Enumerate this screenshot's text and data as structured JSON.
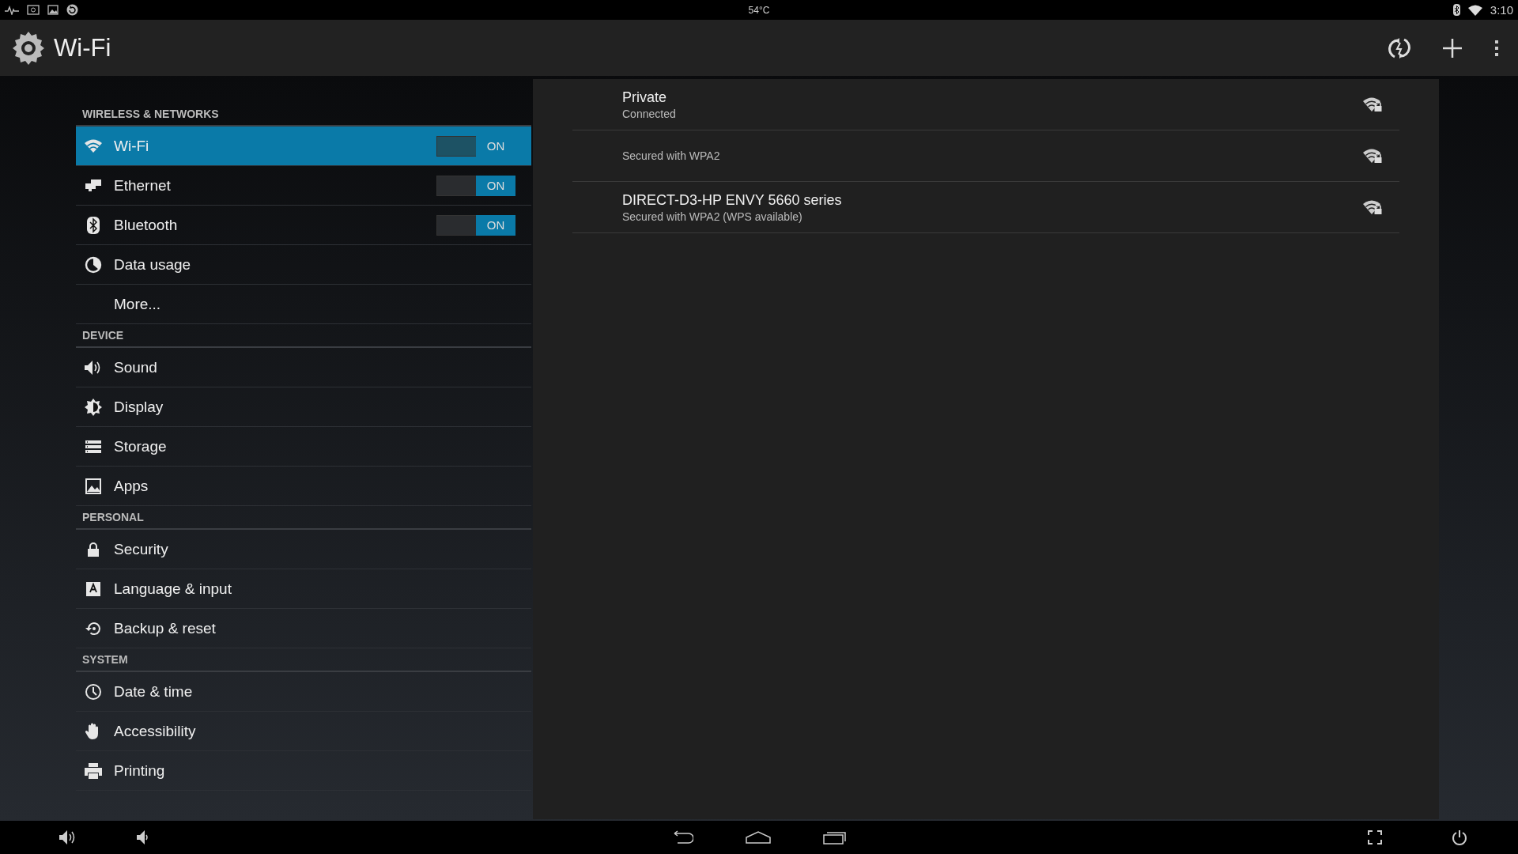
{
  "status_bar": {
    "temperature": "54°C",
    "time": "3:10"
  },
  "action_bar": {
    "title": "Wi-Fi"
  },
  "sections": [
    {
      "title": "WIRELESS & NETWORKS",
      "items": [
        {
          "label": "Wi-Fi",
          "selected": true,
          "toggle": {
            "label": "ON",
            "on": true
          }
        },
        {
          "label": "Ethernet",
          "selected": false,
          "toggle": {
            "label": "ON",
            "on": true
          }
        },
        {
          "label": "Bluetooth",
          "selected": false,
          "toggle": {
            "label": "ON",
            "on": true
          }
        },
        {
          "label": "Data usage",
          "selected": false
        },
        {
          "label": "More...",
          "selected": false
        }
      ]
    },
    {
      "title": "DEVICE",
      "items": [
        {
          "label": "Sound",
          "selected": false
        },
        {
          "label": "Display",
          "selected": false
        },
        {
          "label": "Storage",
          "selected": false
        },
        {
          "label": "Apps",
          "selected": false
        }
      ]
    },
    {
      "title": "PERSONAL",
      "items": [
        {
          "label": "Security",
          "selected": false
        },
        {
          "label": "Language & input",
          "selected": false
        },
        {
          "label": "Backup & reset",
          "selected": false
        }
      ]
    },
    {
      "title": "SYSTEM",
      "items": [
        {
          "label": "Date & time",
          "selected": false
        },
        {
          "label": "Accessibility",
          "selected": false
        },
        {
          "label": "Printing",
          "selected": false
        }
      ]
    }
  ],
  "networks": [
    {
      "name": "Private",
      "status": "Connected"
    },
    {
      "status": "Secured with WPA2"
    },
    {
      "name": "DIRECT-D3-HP ENVY 5660 series",
      "status": "Secured with WPA2 (WPS available)"
    }
  ]
}
